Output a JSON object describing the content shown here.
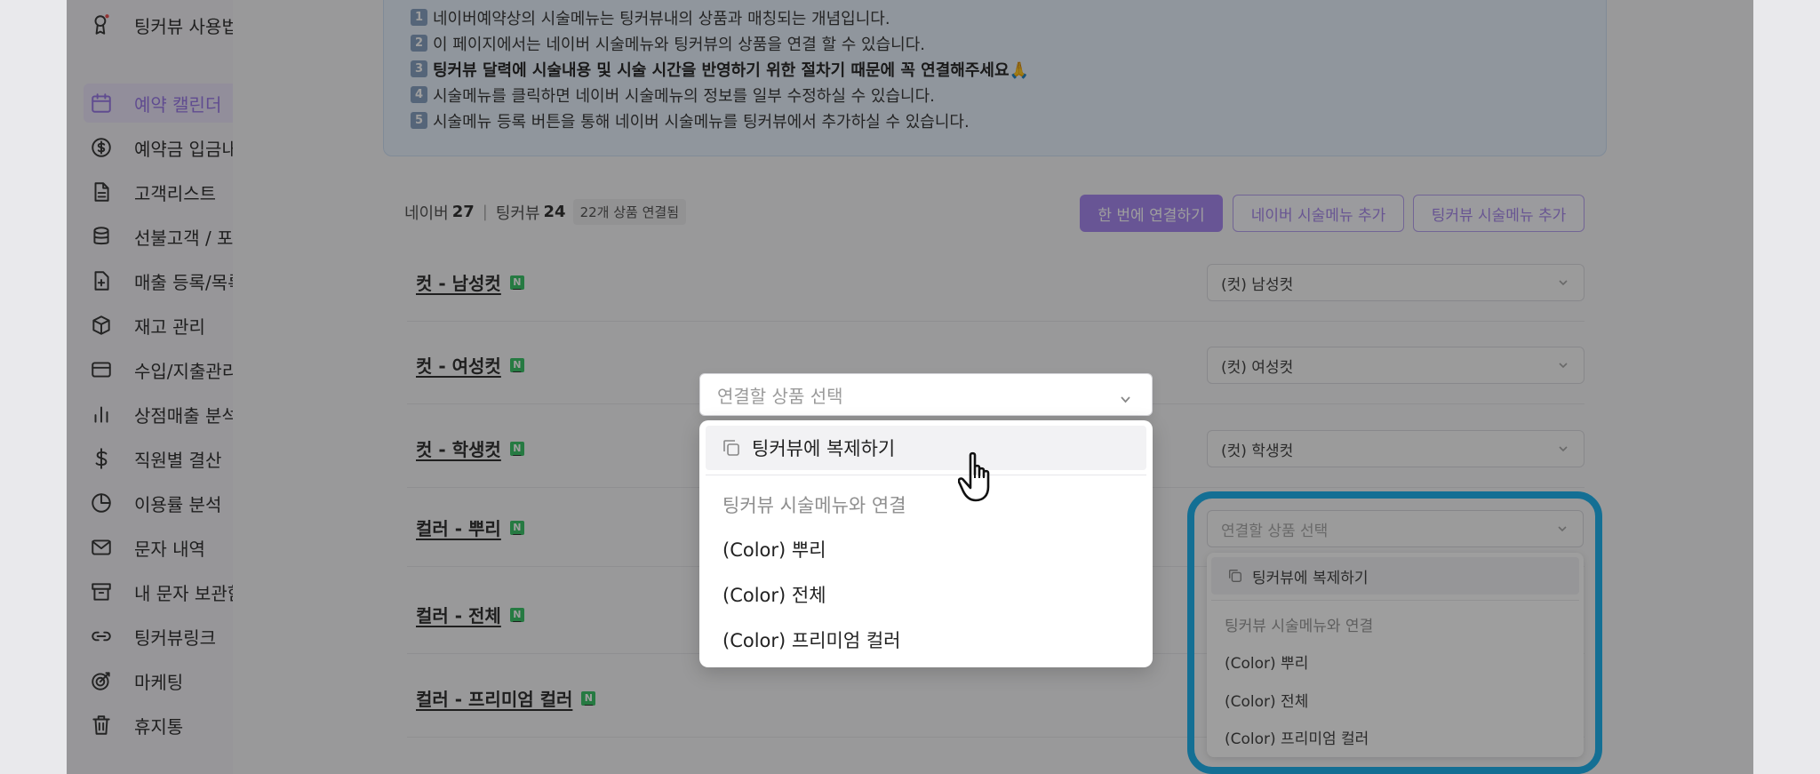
{
  "sidebar": {
    "items": [
      {
        "label": "팅커뷰 사용법",
        "icon": "badge-icon"
      },
      {
        "label": "예약 캘린더",
        "icon": "calendar-icon",
        "active": true
      },
      {
        "label": "예약금 입금내역",
        "icon": "dollar-circle-icon"
      },
      {
        "label": "고객리스트",
        "icon": "document-icon"
      },
      {
        "label": "선불고객 / 포인트",
        "icon": "database-icon"
      },
      {
        "label": "매출 등록/목록",
        "icon": "file-plus-icon"
      },
      {
        "label": "재고 관리",
        "icon": "box-icon"
      },
      {
        "label": "수입/지출관리",
        "icon": "card-icon"
      },
      {
        "label": "상점매출 분석",
        "icon": "bar-chart-icon"
      },
      {
        "label": "직원별 결산",
        "icon": "dollar-icon"
      },
      {
        "label": "이용률 분석",
        "icon": "pie-chart-icon"
      },
      {
        "label": "문자 내역",
        "icon": "mail-icon"
      },
      {
        "label": "내 문자 보관함",
        "icon": "archive-icon"
      },
      {
        "label": "팅커뷰링크",
        "icon": "link-icon"
      },
      {
        "label": "마케팅",
        "icon": "target-icon"
      },
      {
        "label": "휴지통",
        "icon": "trash-icon"
      }
    ]
  },
  "notice": {
    "lines": [
      {
        "num": "1",
        "text": "네이버예약상의 시술메뉴는 팅커뷰내의 상품과 매칭되는 개념입니다."
      },
      {
        "num": "2",
        "text": "이 페이지에서는 네이버 시술메뉴와 팅커뷰의 상품을 연결 할 수 있습니다."
      },
      {
        "num": "3",
        "text": "팅커뷰 달력에 시술내용 및 시술 시간을 반영하기 위한 절차기 때문에 꼭 연결해주세요🙏"
      },
      {
        "num": "4",
        "text": "시술메뉴를 클릭하면 네이버 시술메뉴의 정보를 일부 수정하실 수 있습니다."
      },
      {
        "num": "5",
        "text": "시술메뉴 등록 버튼을 통해 네이버 시술메뉴를 팅커뷰에서 추가하실 수 있습니다."
      }
    ]
  },
  "stats": {
    "naver_label": "네이버",
    "naver_count": "27",
    "tinkerview_label": "팅커뷰",
    "tinkerview_count": "24",
    "linked_badge": "22개 상품 연결됨"
  },
  "buttons": {
    "link_all": "한 번에 연결하기",
    "add_naver_menu": "네이버 시술메뉴 추가",
    "add_tinkerview_menu": "팅커뷰 시술메뉴 추가"
  },
  "rows": [
    {
      "name": "컷 - 남성컷",
      "badge": "N",
      "selected": "(컷) 남성컷"
    },
    {
      "name": "컷 - 여성컷",
      "badge": "N",
      "selected": "(컷) 여성컷"
    },
    {
      "name": "컷 - 학생컷",
      "badge": "N",
      "selected": "(컷) 학생컷"
    },
    {
      "name": "컬러 - 뿌리",
      "badge": "N",
      "selected": ""
    },
    {
      "name": "컬러 - 전체",
      "badge": "N",
      "selected": ""
    },
    {
      "name": "컬러 - 프리미엄 컬러",
      "badge": "N",
      "selected": ""
    }
  ],
  "dropdown": {
    "placeholder": "연결할 상품 선택",
    "duplicate_label": "팅커뷰에 복제하기",
    "group_label": "팅커뷰 시술메뉴와 연결",
    "options": [
      "(Color) 뿌리",
      "(Color) 전체",
      "(Color) 프리미엄 컬러"
    ]
  },
  "colors": {
    "accent": "#a98af0",
    "highlight": "#21b3ef",
    "naver_green": "#3ec56b",
    "notice_bg": "#e9f2fd"
  }
}
